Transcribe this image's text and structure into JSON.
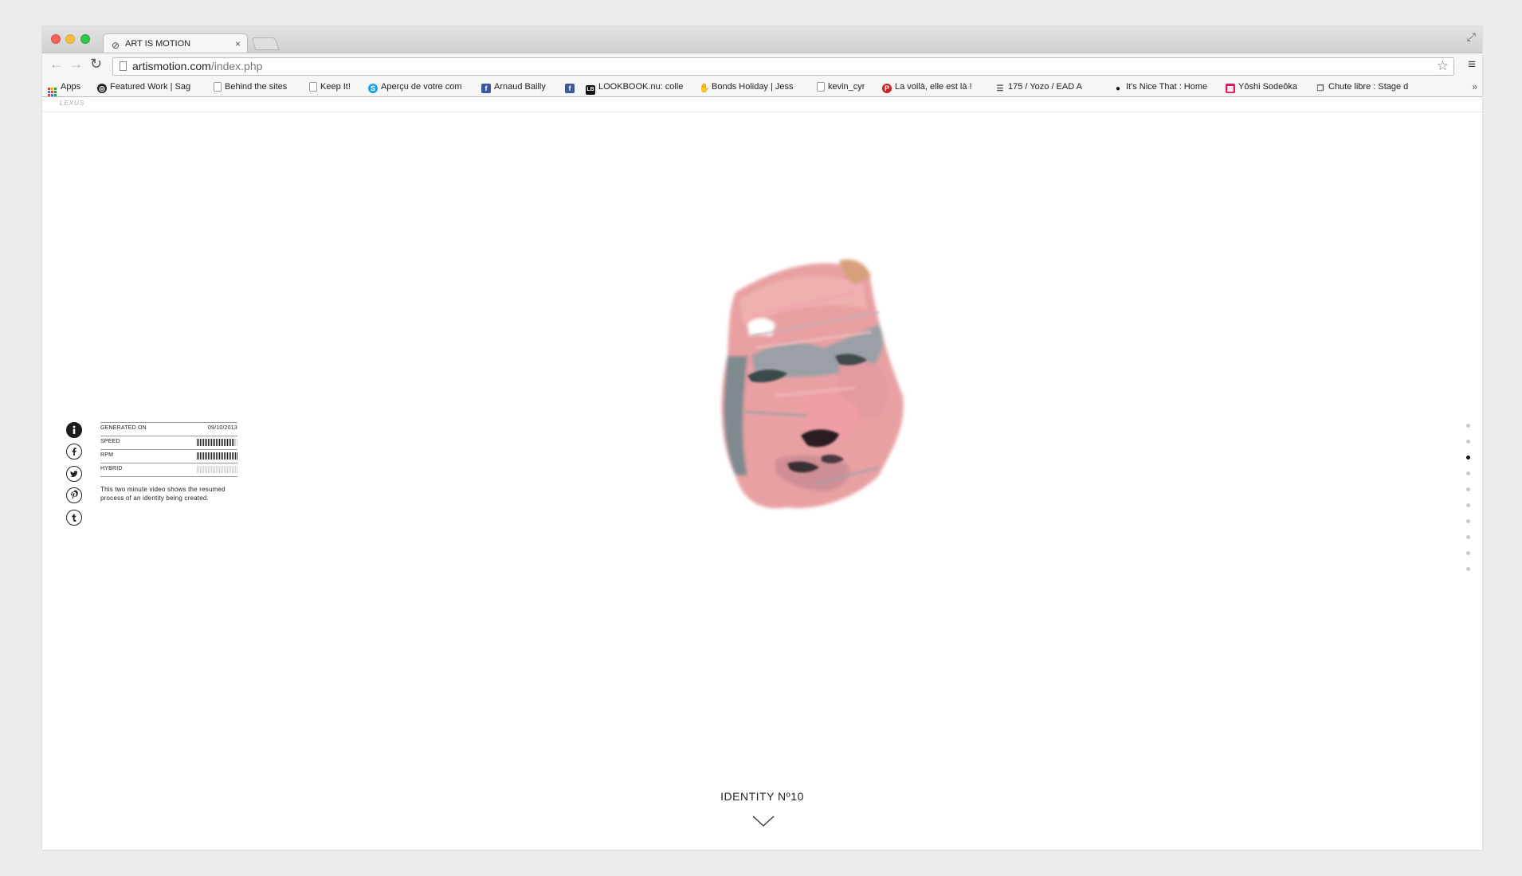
{
  "browser": {
    "tab": {
      "title": "ART IS MOTION",
      "favicon": "lexus-logo-icon",
      "close": "×"
    },
    "url": {
      "host": "artismotion.com",
      "path": "/index.php"
    },
    "bookmarks": [
      {
        "label": "Apps",
        "icon": "apps-grid-icon"
      },
      {
        "label": "Featured Work | Sag",
        "icon": "circle-icon"
      },
      {
        "label": "Behind the sites",
        "icon": "page-icon"
      },
      {
        "label": "Keep It!",
        "icon": "page-icon"
      },
      {
        "label": "Aperçu de votre com",
        "icon": "skype-icon"
      },
      {
        "label": "Arnaud Bailly",
        "icon": "facebook-icon"
      },
      {
        "label": "",
        "icon": "facebook-icon"
      },
      {
        "label": "LOOKBOOK.nu: colle",
        "icon": "lookbook-icon"
      },
      {
        "label": "Bonds Holiday | Jess",
        "icon": "hand-icon"
      },
      {
        "label": "kevin_cyr",
        "icon": "page-icon"
      },
      {
        "label": "La voilà, elle est là !",
        "icon": "pinterest-icon"
      },
      {
        "label": "175 / Yozo / EAD A",
        "icon": "list-icon"
      },
      {
        "label": "It's Nice That : Home",
        "icon": "dot-icon"
      },
      {
        "label": "Yôshi Sodeôka",
        "icon": "tile-icon"
      },
      {
        "label": "Chute libre : Stage d",
        "icon": "chat-icon"
      }
    ],
    "bookmarks_more": "»",
    "colors": {
      "red": "#fc605c",
      "yellow": "#fdbc40",
      "green": "#34c84a"
    }
  },
  "site": {
    "logo": "LEXUS",
    "info": {
      "rows": [
        {
          "label": "GENERATED ON",
          "value": "09/10/2013"
        },
        {
          "label": "SPEED",
          "level": 0.92
        },
        {
          "label": "RPM",
          "level": 1.0
        },
        {
          "label": "HYBRID",
          "level": 0.0
        }
      ],
      "description": "This two minute video shows the resumed process of an identity being created."
    },
    "social_icons": [
      "info-icon",
      "facebook-icon",
      "twitter-icon",
      "pinterest-icon",
      "tumblr-icon"
    ],
    "pager": {
      "count": 10,
      "active": 2
    },
    "identity_title": "IDENTITY Nº10"
  }
}
